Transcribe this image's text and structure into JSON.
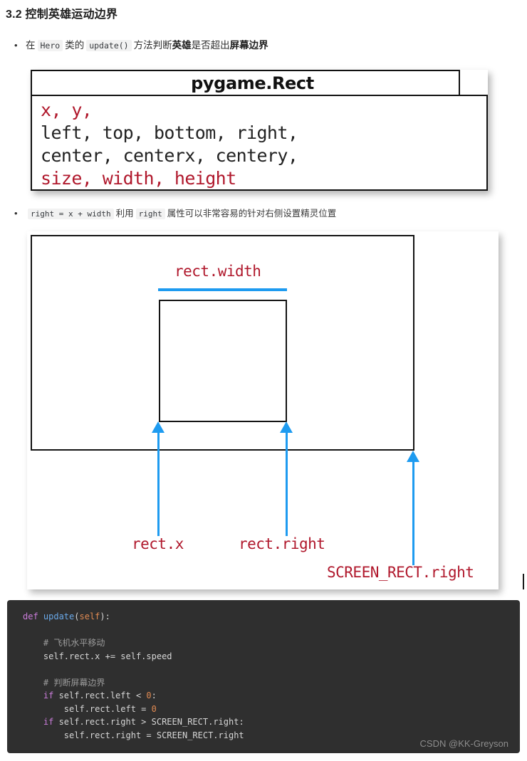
{
  "heading": "3.2 控制英雄运动边界",
  "bullets": [
    {
      "parts": [
        {
          "type": "zh",
          "text": "在"
        },
        {
          "type": "code",
          "text": "Hero"
        },
        {
          "type": "zh",
          "text": "类的"
        },
        {
          "type": "code",
          "text": "update()"
        },
        {
          "type": "zh",
          "text": "方法判断"
        },
        {
          "type": "strong",
          "text": "英雄"
        },
        {
          "type": "zh",
          "text": "是否超出"
        },
        {
          "type": "strong",
          "text": "屏幕边界"
        }
      ]
    },
    {
      "parts": [
        {
          "type": "code",
          "text": "right = x + width"
        },
        {
          "type": "zh",
          "text": "利用"
        },
        {
          "type": "code",
          "text": "right"
        },
        {
          "type": "zh",
          "text": "属性可以非常容易的针对右侧设置精灵位置"
        }
      ]
    }
  ],
  "rect_figure": {
    "title": "pygame.Rect",
    "lines": [
      {
        "text": "x, y,",
        "color": "red"
      },
      {
        "text": "left, top, bottom, right,",
        "color": "black"
      },
      {
        "text": "center, centerx, centery,",
        "color": "black"
      },
      {
        "text": "size, width, height",
        "color": "red"
      }
    ]
  },
  "diagram": {
    "label_width": "rect.width",
    "label_rect_x": "rect.x",
    "label_rect_right": "rect.right",
    "label_screen_rect_right": "SCREEN_RECT.right",
    "accent_blue": "#1e9bf0",
    "label_red": "#b0182c"
  },
  "code": {
    "lines": [
      [
        {
          "t": "def ",
          "c": "kw"
        },
        {
          "t": "update",
          "c": "fn"
        },
        {
          "t": "(",
          "c": "pun"
        },
        {
          "t": "self",
          "c": "selfp"
        },
        {
          "t": "):",
          "c": "pun"
        }
      ],
      [
        {
          "t": "",
          "c": "plain"
        }
      ],
      [
        {
          "t": "    # 飞机水平移动",
          "c": "cmt"
        }
      ],
      [
        {
          "t": "    self.rect.x += self.speed",
          "c": "plain"
        }
      ],
      [
        {
          "t": "",
          "c": "plain"
        }
      ],
      [
        {
          "t": "    # 判断屏幕边界",
          "c": "cmt"
        }
      ],
      [
        {
          "t": "    ",
          "c": "plain"
        },
        {
          "t": "if",
          "c": "kw"
        },
        {
          "t": " self.rect.left < ",
          "c": "plain"
        },
        {
          "t": "0",
          "c": "num"
        },
        {
          "t": ":",
          "c": "plain"
        }
      ],
      [
        {
          "t": "        self.rect.left = ",
          "c": "plain"
        },
        {
          "t": "0",
          "c": "num"
        }
      ],
      [
        {
          "t": "    ",
          "c": "plain"
        },
        {
          "t": "if",
          "c": "kw"
        },
        {
          "t": " self.rect.right > SCREEN_RECT.right:",
          "c": "plain"
        }
      ],
      [
        {
          "t": "        self.rect.right = SCREEN_RECT.right",
          "c": "plain"
        }
      ]
    ],
    "background": "#2f2f2f"
  },
  "watermark": "CSDN @KK-Greyson"
}
